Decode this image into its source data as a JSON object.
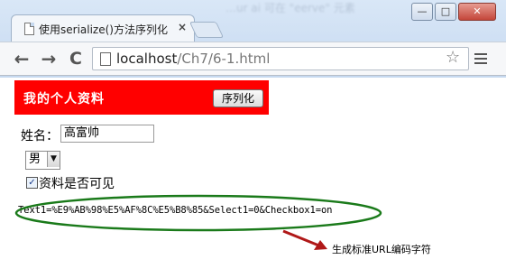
{
  "browser": {
    "tab_title": "使用serialize()方法序列化",
    "tab_close": "×",
    "url_host": "localhost",
    "url_path": "/Ch7/6-1.html",
    "back": "←",
    "forward": "→",
    "reload": "C",
    "star": "☆",
    "window_min": "—",
    "window_max": "□",
    "window_close": "✕",
    "background_text": "…ur ai 可在 \"eerve\" 元素"
  },
  "page": {
    "title": "我的个人资料",
    "serialize_button": "序列化",
    "name_label": "姓名：",
    "name_value": "高富帅",
    "gender_value": "男",
    "checkbox_checked": true,
    "checkbox_label": "资料是否可见",
    "serialized_result": "Text1=%E9%AB%98%E5%AF%8C%E5%B8%85&Select1=0&Checkbox1=on"
  },
  "annotation": {
    "label": "生成标准URL编码字符",
    "ellipse_color": "#1a7a1a",
    "arrow_color": "#b01818"
  },
  "colors": {
    "title_bar": "#ff0000"
  }
}
